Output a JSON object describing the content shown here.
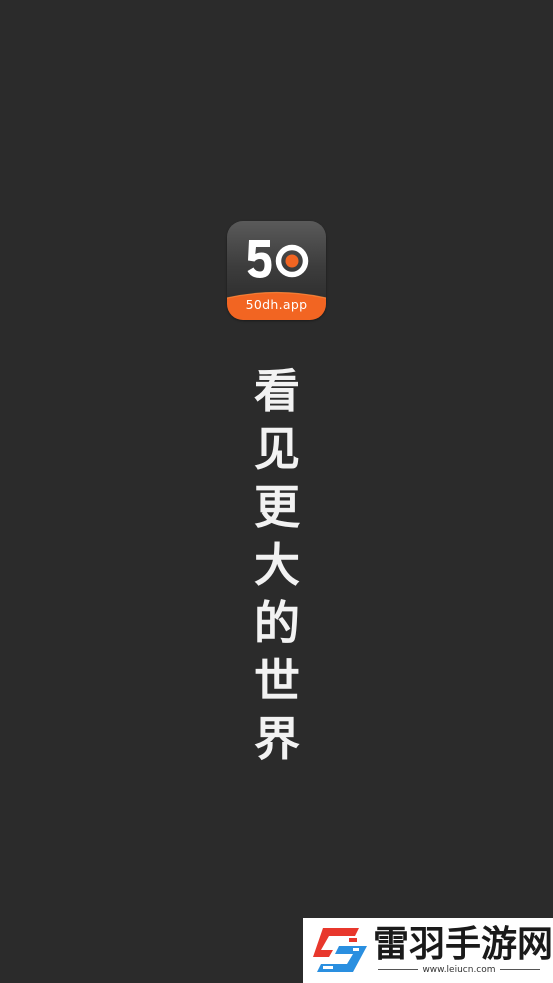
{
  "app": {
    "logo_number": "50",
    "logo_domain": "50dh.app",
    "slogan": "看见更大的世界"
  },
  "watermark": {
    "site_name": "雷羽手游网",
    "site_url": "www.leiucn.com"
  },
  "colors": {
    "background": "#2b2b2b",
    "accent_orange": "#f26522",
    "slogan_text": "#f2f2f2",
    "watermark_red": "#e8372c",
    "watermark_blue": "#2a8fe0"
  },
  "icons": {
    "app_logo": "50dh-app-logo",
    "watermark_logo": "leiyu-logo-icon"
  }
}
